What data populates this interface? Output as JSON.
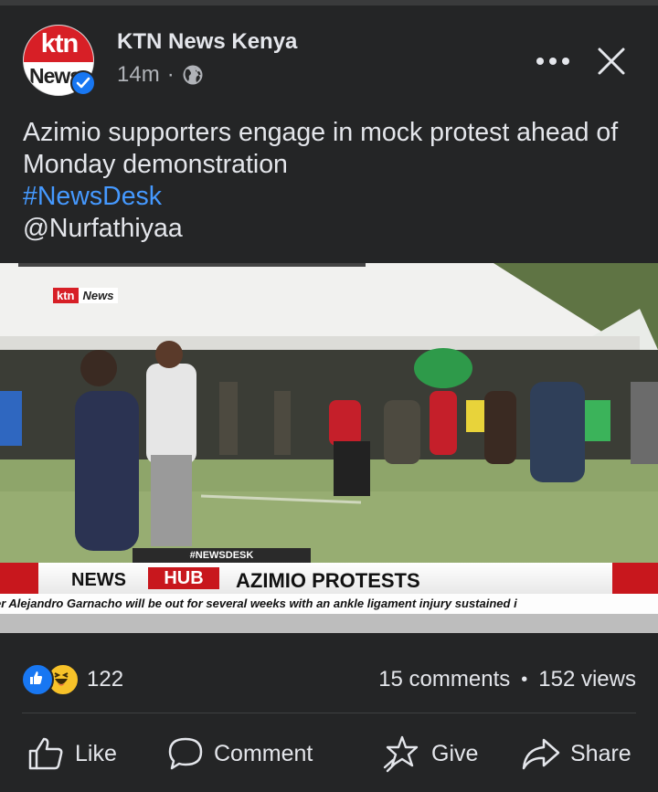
{
  "post": {
    "page_name": "KTN News Kenya",
    "time": "14m",
    "separator": "·",
    "avatar": {
      "line1": "ktn",
      "line2": "News"
    },
    "caption": {
      "text": "Azimio supporters engage in mock protest ahead of Monday demonstration",
      "hashtag": "#NewsDesk",
      "mention": "@Nurfathiyaa"
    }
  },
  "video": {
    "logo": {
      "ktn": "ktn",
      "news": "News"
    },
    "desk_tag": "#NEWSDESK",
    "lower_third": {
      "news": "NEWS",
      "hub": "HUB",
      "title": "AZIMIO PROTESTS"
    },
    "ticker": "er Alejandro Garnacho will be out for several weeks with an ankle ligament injury sustained i"
  },
  "engagement": {
    "reaction_count": "122",
    "comments": "15 comments",
    "bullet": "•",
    "views": "152 views"
  },
  "actions": {
    "like": "Like",
    "comment": "Comment",
    "give": "Give",
    "share": "Share"
  },
  "colors": {
    "background": "#242526",
    "accent": "#1877f2",
    "hashtag": "#4599ff",
    "brand_red": "#d71f26"
  },
  "icons": [
    "verified-badge-icon",
    "globe-icon",
    "more-icon",
    "close-icon",
    "like-reaction-icon",
    "haha-reaction-icon",
    "thumbs-up-icon",
    "comment-icon",
    "give-icon",
    "share-icon"
  ]
}
